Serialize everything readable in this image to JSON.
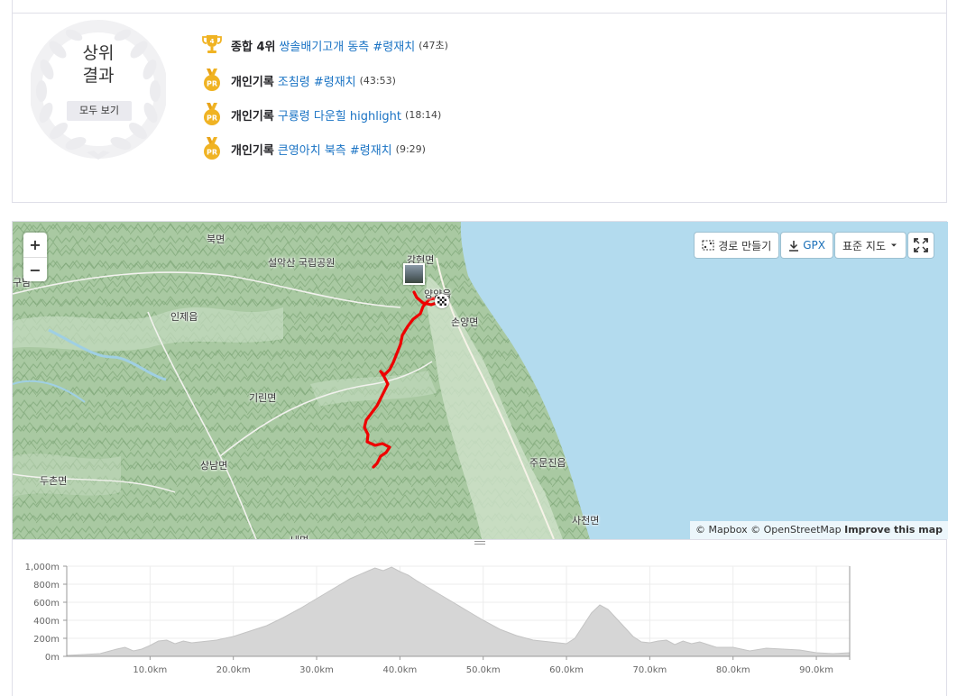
{
  "top_results": {
    "title": "상위\n결과",
    "see_all_label": "모두 보기",
    "items": [
      {
        "icon": "trophy-rank-4-icon",
        "rank_badge": "4",
        "kind": "종합 4위",
        "segment": "쌍솔배기고개 동측 #령재치",
        "time": "(47초)"
      },
      {
        "icon": "pr-medal-icon",
        "rank_badge": "PR",
        "kind": "개인기록",
        "segment": "조침령 #령재치",
        "time": "(43:53)"
      },
      {
        "icon": "pr-medal-icon",
        "rank_badge": "PR",
        "kind": "개인기록",
        "segment": "구룡령 다운힐 highlight",
        "time": "(18:14)"
      },
      {
        "icon": "pr-medal-icon",
        "rank_badge": "PR",
        "kind": "개인기록",
        "segment": "큰영아치 북측 #령재치",
        "time": "(9:29)"
      }
    ],
    "colors": {
      "link": "#1a73c4",
      "medal_gold": "#f0b323"
    }
  },
  "map": {
    "zoom_in": "+",
    "zoom_out": "−",
    "toolbar": {
      "route_builder": "경로 만들기",
      "gpx": "GPX",
      "map_style": "표준 지도"
    },
    "labels": {
      "bukmyeon": "북면",
      "seorak": "설악산 국립공원",
      "gangmyeon": "강현면",
      "guda": "구남",
      "inje": "인제읍",
      "yangyang": "양양읍",
      "sonyang": "손양면",
      "girin": "기린면",
      "sangnam": "상남면",
      "duchon": "두촌면",
      "jumunjin": "주문진읍",
      "sacheon": "사천면",
      "bottom_partial": "내면"
    },
    "attribution": {
      "mapbox": "© Mapbox",
      "osm": "© OpenStreetMap",
      "improve": "Improve this map"
    },
    "colors": {
      "route": "#ee0000",
      "water": "#b3dbee",
      "land": "#a8c9a1"
    }
  },
  "chart_data": {
    "type": "area",
    "title": "",
    "xlabel": "",
    "ylabel": "",
    "x_unit": "km",
    "y_unit": "m",
    "ylim": [
      0,
      1000
    ],
    "xlim": [
      0,
      94
    ],
    "y_ticks": [
      "0m",
      "200m",
      "400m",
      "600m",
      "800m",
      "1,000m"
    ],
    "x_ticks": [
      "10.0km",
      "20.0km",
      "30.0km",
      "40.0km",
      "50.0km",
      "60.0km",
      "70.0km",
      "80.0km",
      "90.0km"
    ],
    "x": [
      0,
      2,
      4,
      6,
      7,
      8,
      9,
      10,
      11,
      12,
      13,
      14,
      15,
      16,
      18,
      20,
      22,
      24,
      26,
      28,
      30,
      32,
      34,
      36,
      37,
      38,
      39,
      40,
      41,
      42,
      44,
      46,
      48,
      50,
      52,
      54,
      56,
      58,
      60,
      61,
      62,
      63,
      64,
      65,
      66,
      67,
      68,
      69,
      70,
      71,
      72,
      73,
      74,
      75,
      76,
      77,
      78,
      80,
      82,
      84,
      86,
      88,
      90,
      92,
      94
    ],
    "y": [
      10,
      20,
      30,
      80,
      100,
      60,
      80,
      120,
      170,
      180,
      140,
      170,
      150,
      160,
      180,
      220,
      280,
      340,
      430,
      530,
      640,
      750,
      860,
      940,
      980,
      950,
      990,
      940,
      900,
      840,
      730,
      620,
      510,
      400,
      300,
      230,
      180,
      160,
      140,
      200,
      340,
      480,
      570,
      520,
      420,
      320,
      220,
      160,
      150,
      170,
      180,
      130,
      170,
      140,
      160,
      130,
      100,
      100,
      60,
      90,
      80,
      70,
      40,
      30,
      40
    ],
    "fill_color": "#d6d6d6",
    "grid": true
  }
}
